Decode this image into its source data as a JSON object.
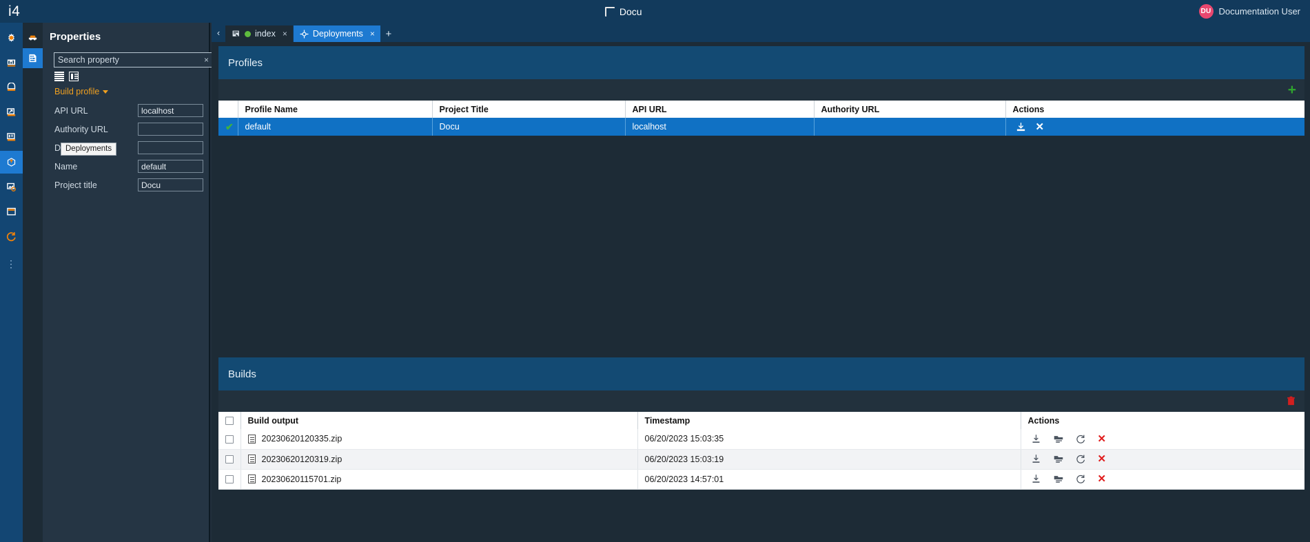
{
  "topbar": {
    "logo": "i4",
    "doc_icon": "document-icon",
    "title": "Docu",
    "user_initials": "DU",
    "user_name": "Documentation User"
  },
  "rail": {
    "items": [
      {
        "name": "settings-gear",
        "label": "Settings"
      },
      {
        "name": "dashboard",
        "label": "Dashboard"
      },
      {
        "name": "archive",
        "label": "Archive"
      },
      {
        "name": "export",
        "label": "Export"
      },
      {
        "name": "list-view",
        "label": "List"
      },
      {
        "name": "deployments",
        "label": "Deployments",
        "active": true
      },
      {
        "name": "image-settings",
        "label": "Media settings"
      },
      {
        "name": "window",
        "label": "Window"
      },
      {
        "name": "refresh",
        "label": "Refresh"
      }
    ],
    "overflow": "⋮"
  },
  "rail2": {
    "items": [
      {
        "name": "vehicle",
        "label": "Model"
      },
      {
        "name": "structure",
        "label": "Structure",
        "active": true
      }
    ]
  },
  "properties": {
    "title": "Properties",
    "search": {
      "value": "Search property",
      "placeholder": "Search property",
      "clear": "×"
    },
    "view_modes": [
      "list-view-icon",
      "table-view-icon"
    ],
    "group": {
      "label": "Build profile",
      "expanded": true
    },
    "fields": [
      {
        "label": "API URL",
        "value": "localhost"
      },
      {
        "label": "Authority URL",
        "value": ""
      },
      {
        "label": "Description",
        "value": ""
      },
      {
        "label": "Name",
        "value": "default"
      },
      {
        "label": "Project title",
        "value": "Docu"
      }
    ],
    "tooltip": "Deployments"
  },
  "tabs": {
    "prev_label": "‹",
    "items": [
      {
        "label": "index",
        "icon": "page-icon",
        "status": "green",
        "active": false,
        "close": "×"
      },
      {
        "label": "Deployments",
        "icon": "deploy-icon",
        "active": true,
        "close": "×"
      }
    ],
    "add_label": "+"
  },
  "profiles": {
    "title": "Profiles",
    "add_label": "+",
    "columns": [
      "Profile Name",
      "Project Title",
      "API URL",
      "Authority URL",
      "Actions"
    ],
    "rows": [
      {
        "selected": true,
        "check": "✔",
        "profile_name": "default",
        "project_title": "Docu",
        "api_url": "localhost",
        "authority_url": "",
        "actions": [
          "save-icon",
          "close-icon"
        ]
      }
    ]
  },
  "builds": {
    "title": "Builds",
    "delete_label": "delete-icon",
    "columns": [
      "",
      "Build output",
      "Timestamp",
      "Actions"
    ],
    "rows": [
      {
        "output": "20230620120335.zip",
        "timestamp": "06/20/2023 15:03:35",
        "actions": [
          "download-icon",
          "folder-icon",
          "redeploy-icon",
          "delete-x-icon"
        ]
      },
      {
        "output": "20230620120319.zip",
        "timestamp": "06/20/2023 15:03:19",
        "actions": [
          "download-icon",
          "folder-icon",
          "redeploy-icon",
          "delete-x-icon"
        ]
      },
      {
        "output": "20230620115701.zip",
        "timestamp": "06/20/2023 14:57:01",
        "actions": [
          "download-icon",
          "folder-icon",
          "redeploy-icon",
          "delete-x-icon"
        ]
      }
    ]
  },
  "colors": {
    "topbar_bg": "#123a5c",
    "rail_bg": "#134673",
    "accent_blue": "#1e7ad1",
    "panel_header": "#134a73",
    "orange": "#f0a020",
    "green": "#3fb23f",
    "red": "#e01b1b",
    "avatar": "#e8476f"
  }
}
